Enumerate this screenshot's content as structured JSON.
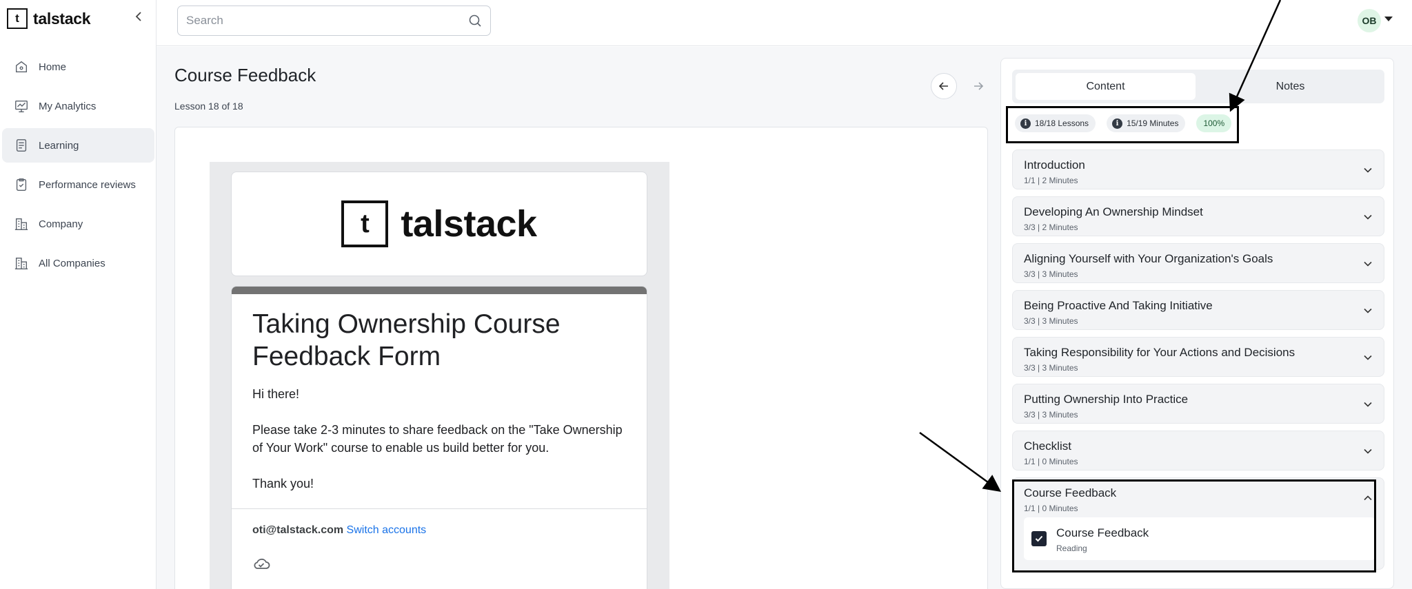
{
  "app": {
    "logo_text": "talstack",
    "logo_mark": "t"
  },
  "sidebar": {
    "items": [
      {
        "label": "Home",
        "icon": "home-icon"
      },
      {
        "label": "My Analytics",
        "icon": "analytics-icon"
      },
      {
        "label": "Learning",
        "icon": "learning-icon",
        "active": true
      },
      {
        "label": "Performance reviews",
        "icon": "clipboard-check-icon"
      },
      {
        "label": "Company",
        "icon": "building-icon"
      },
      {
        "label": "All Companies",
        "icon": "buildings-icon"
      }
    ]
  },
  "header": {
    "search_placeholder": "Search",
    "avatar_initials": "OB"
  },
  "main": {
    "title": "Course Feedback",
    "lesson_count": "Lesson 18 of 18"
  },
  "form": {
    "logo_text": "talstack",
    "logo_mark": "t",
    "title": "Taking Ownership Course Feedback Form",
    "description": "Hi there!\n\nPlease take 2-3 minutes to share feedback on the \"Take Ownership of Your Work\" course to enable us build better for you.\n\nThank you!",
    "account_email": "oti@talstack.com",
    "switch_label": "Switch accounts"
  },
  "panel": {
    "tabs": {
      "content": "Content",
      "notes": "Notes"
    },
    "stats": {
      "lessons": "18/18 Lessons",
      "minutes": "15/19 Minutes",
      "progress": "100%"
    },
    "sections": [
      {
        "title": "Introduction",
        "meta": "1/1 | 2 Minutes"
      },
      {
        "title": "Developing An Ownership Mindset",
        "meta": "3/3 | 2 Minutes"
      },
      {
        "title": "Aligning Yourself with Your Organization's Goals",
        "meta": "3/3 | 3 Minutes"
      },
      {
        "title": "Being Proactive And Taking Initiative",
        "meta": "3/3 | 3 Minutes"
      },
      {
        "title": "Taking Responsibility for Your Actions and Decisions",
        "meta": "3/3 | 3 Minutes"
      },
      {
        "title": "Putting Ownership Into Practice",
        "meta": "3/3 | 3 Minutes"
      },
      {
        "title": "Checklist",
        "meta": "1/1 | 0 Minutes"
      }
    ],
    "open_section": {
      "title": "Course Feedback",
      "meta": "1/1 | 0 Minutes",
      "lesson": {
        "title": "Course Feedback",
        "type": "Reading"
      }
    }
  },
  "colors": {
    "accent_dark": "#1d2433",
    "progress_green_bg": "#dcf5e6",
    "link_blue": "#1a73e8",
    "annotation": "#000000"
  }
}
